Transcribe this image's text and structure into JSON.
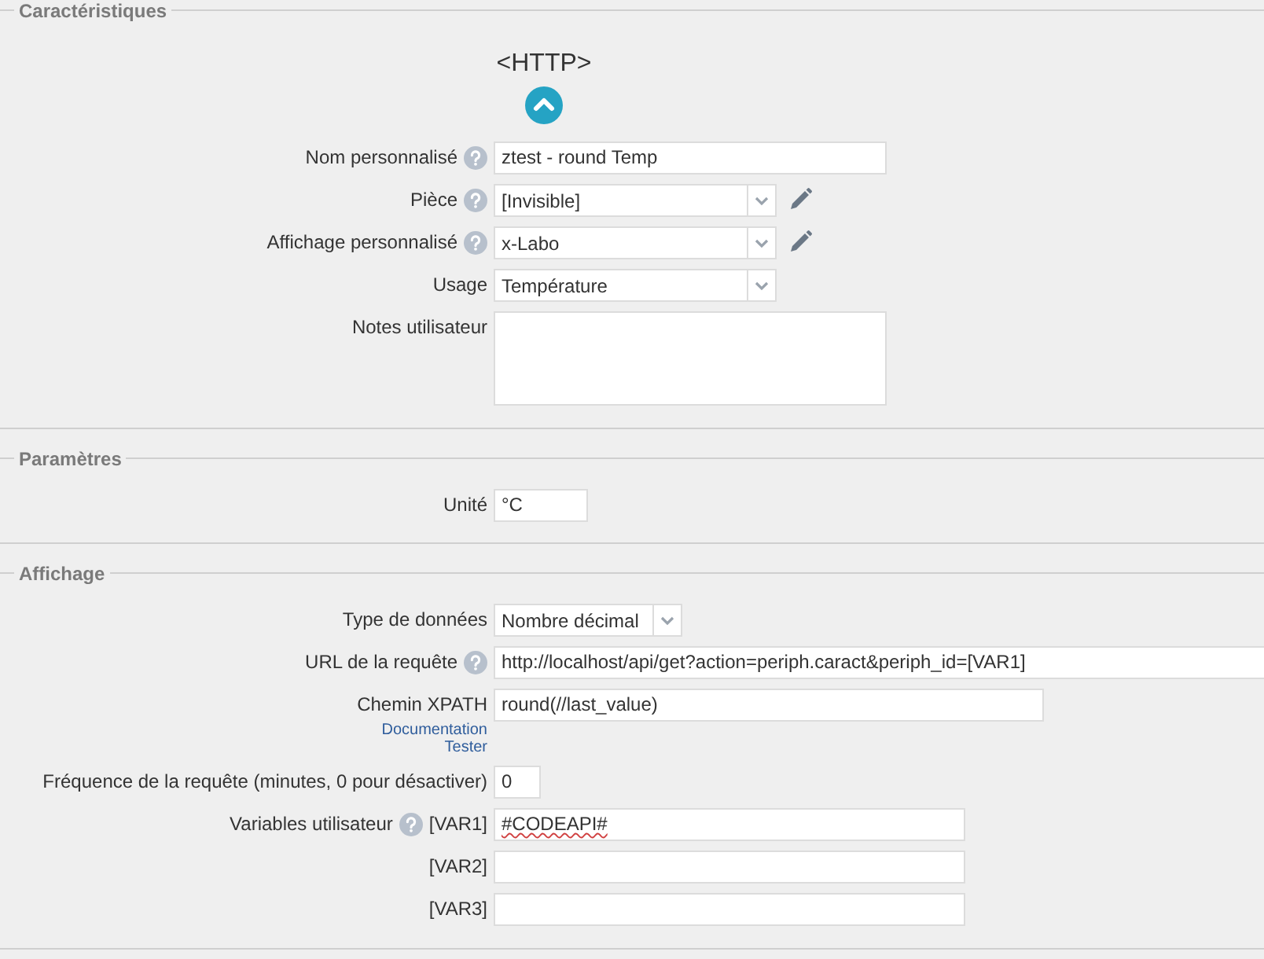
{
  "sections": [
    {
      "legend": "Caractéristiques",
      "header": {
        "title": "<HTTP>"
      },
      "rows": [
        {
          "kind": "text",
          "label": "Nom personnalisé",
          "help": true,
          "value": "ztest - round Temp"
        },
        {
          "kind": "select",
          "label": "Pièce",
          "help": true,
          "value": "[Invisible]",
          "editable": true
        },
        {
          "kind": "select",
          "label": "Affichage personnalisé",
          "help": true,
          "value": "x-Labo",
          "editable": true
        },
        {
          "kind": "select",
          "label": "Usage",
          "help": false,
          "value": "Température",
          "editable": false
        },
        {
          "kind": "textarea",
          "label": "Notes utilisateur",
          "help": false
        }
      ]
    },
    {
      "legend": "Paramètres",
      "rows": [
        {
          "kind": "text",
          "label": "Unité",
          "help": false,
          "value": "°C"
        }
      ]
    },
    {
      "legend": "Affichage",
      "rows": [
        {
          "kind": "select",
          "label": "Type de données",
          "help": false,
          "value": "Nombre décimal",
          "editable": false
        },
        {
          "kind": "text",
          "label": "URL de la requête",
          "help": true,
          "value": "http://localhost/api/get?action=periph.caract&periph_id=[VAR1]"
        },
        {
          "kind": "text",
          "label": "Chemin XPATH",
          "help": false,
          "value": "round(//last_value)",
          "links": [
            "Documentation",
            "Tester"
          ]
        },
        {
          "kind": "text",
          "label": "Fréquence de la requête (minutes, 0 pour désactiver)",
          "help": false,
          "value": "0"
        },
        {
          "kind": "text",
          "label": "Variables utilisateur",
          "help": true,
          "sublabel": "[VAR1]",
          "value": "#CODEAPI#",
          "misspelled": true
        },
        {
          "kind": "text",
          "help": false,
          "sublabel": "[VAR2]"
        },
        {
          "kind": "text",
          "help": false,
          "sublabel": "[VAR3]"
        }
      ]
    }
  ]
}
